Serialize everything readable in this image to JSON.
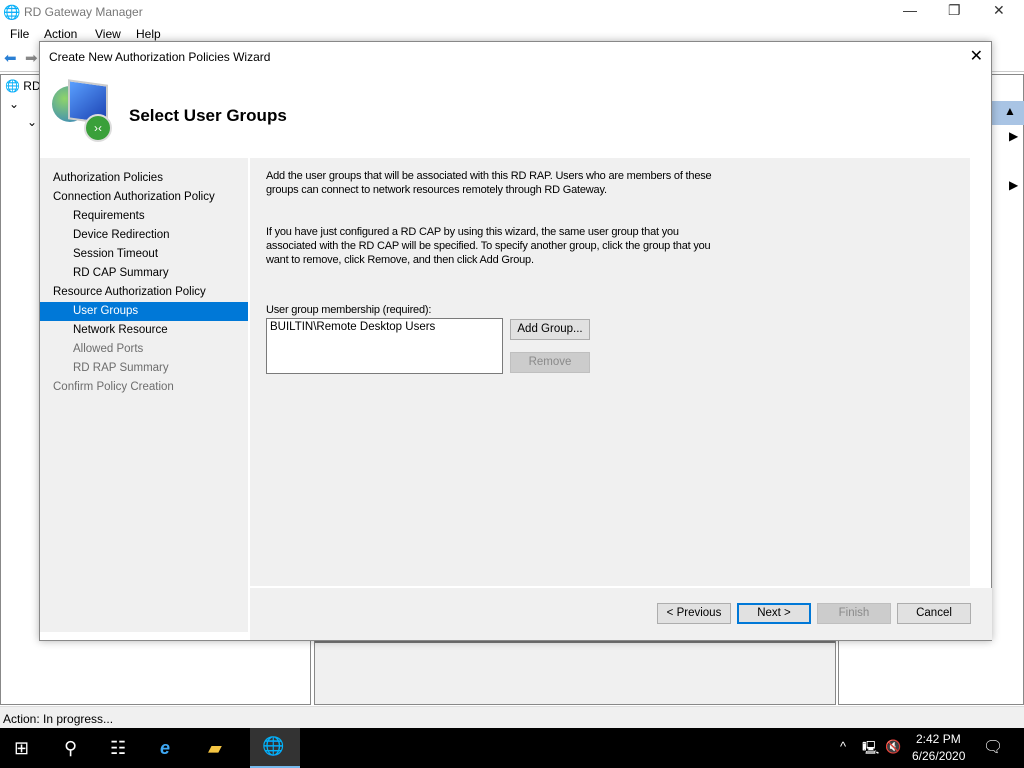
{
  "app": {
    "title": "RD Gateway Manager",
    "menu": [
      "File",
      "Action",
      "View",
      "Help"
    ],
    "tree_root": "RD",
    "status": "Action:  In progress..."
  },
  "wizard": {
    "title": "Create New Authorization Policies Wizard",
    "heading": "Select User Groups",
    "nav": [
      {
        "label": "Authorization Policies",
        "level": 0,
        "state": "normal"
      },
      {
        "label": "Connection Authorization Policy",
        "level": 0,
        "state": "normal"
      },
      {
        "label": "Requirements",
        "level": 1,
        "state": "normal"
      },
      {
        "label": "Device Redirection",
        "level": 1,
        "state": "normal"
      },
      {
        "label": "Session Timeout",
        "level": 1,
        "state": "normal"
      },
      {
        "label": "RD CAP Summary",
        "level": 1,
        "state": "normal"
      },
      {
        "label": "Resource Authorization Policy",
        "level": 0,
        "state": "normal"
      },
      {
        "label": "User Groups",
        "level": 1,
        "state": "selected"
      },
      {
        "label": "Network Resource",
        "level": 1,
        "state": "normal"
      },
      {
        "label": "Allowed Ports",
        "level": 1,
        "state": "disabled"
      },
      {
        "label": "RD RAP Summary",
        "level": 1,
        "state": "disabled"
      },
      {
        "label": "Confirm Policy Creation",
        "level": 0,
        "state": "disabled"
      }
    ],
    "para1_l1": "Add the user groups that will be associated with this RD RAP. Users who are members of these",
    "para1_l2": "groups can connect to network resources remotely through RD Gateway.",
    "para2_l1": "If you have just configured a RD CAP by using this wizard, the same user group that you",
    "para2_l2": "associated with the RD CAP will be specified. To specify another group, click the group that you",
    "para2_l3": "want to remove, click Remove, and then click Add Group.",
    "list_label": "User group membership (required):",
    "groups": [
      "BUILTIN\\Remote Desktop Users"
    ],
    "add_group": "Add Group...",
    "remove": "Remove",
    "previous": "< Previous",
    "next": "Next >",
    "finish": "Finish",
    "cancel": "Cancel"
  },
  "taskbar": {
    "time": "2:42 PM",
    "date": "6/26/2020"
  }
}
